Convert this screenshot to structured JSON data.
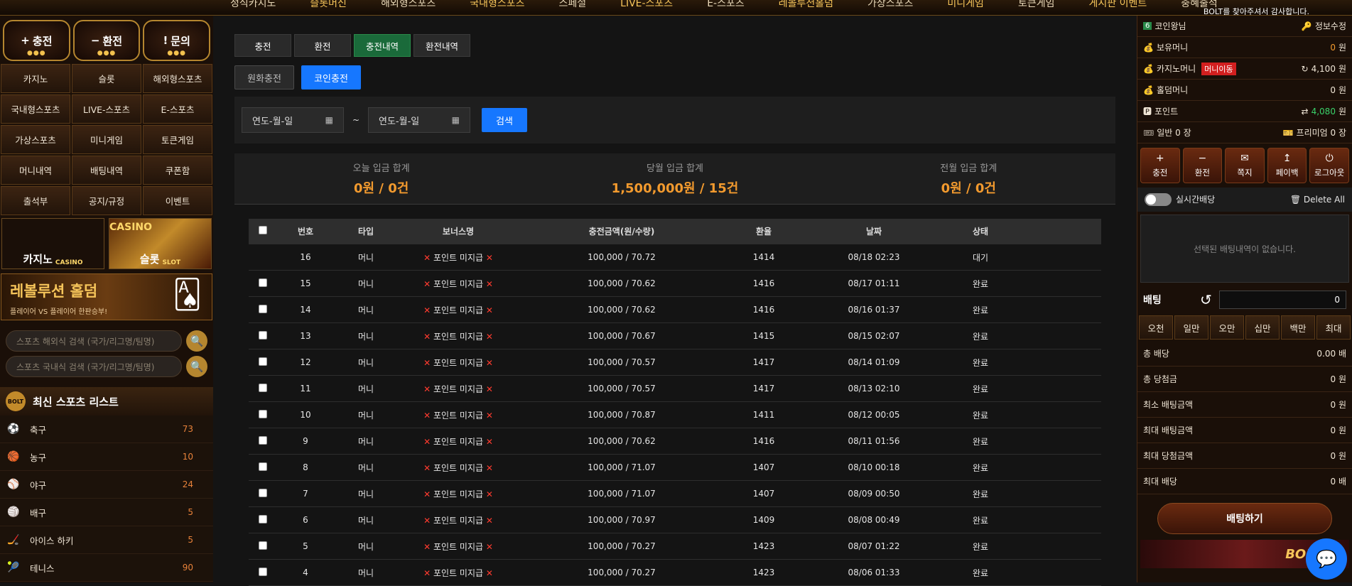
{
  "topnav": {
    "items": [
      "정식카지노",
      "슬롯머신",
      "해외형스포츠",
      "국내형스포츠",
      "스페셜",
      "LIVE-스포츠",
      "E-스포츠",
      "레볼루션홀덤",
      "가상스포츠",
      "미니게임",
      "토큰게임",
      "게시판 이벤트",
      "충혜출석"
    ],
    "notice": "BOLT를 찾아주셔서 감사합니다."
  },
  "left": {
    "header_buttons": [
      {
        "icon": "+",
        "label": "충전"
      },
      {
        "icon": "−",
        "label": "환전"
      },
      {
        "icon": "!",
        "label": "문의"
      }
    ],
    "grid": [
      "카지노",
      "슬롯",
      "해외형스포츠",
      "국내형스포츠",
      "LIVE-스포츠",
      "E-스포츠",
      "가상스포츠",
      "미니게임",
      "토큰게임",
      "머니내역",
      "배팅내역",
      "쿠폰함",
      "출석부",
      "공지/규정",
      "이벤트"
    ],
    "banner_casino": {
      "title": "카지노",
      "sub": "CASINO"
    },
    "banner_slot": {
      "top": "CASINO",
      "title": "슬롯",
      "sub": "SLOT"
    },
    "holdem": {
      "title": "레볼루션 홀덤",
      "sub": "플레이어 VS 플레이어 한판승부!"
    },
    "search_overseas_placeholder": "스포츠 해외식 검색 (국가/리그명/팀명)",
    "search_domestic_placeholder": "스포츠 국내식 검색 (국가/리그명/팀명)",
    "sport_list_title": "최신 스포츠 리스트",
    "sport_list_logo": "BOLT",
    "sports": [
      {
        "name": "축구",
        "count": "73",
        "icon": "⚽"
      },
      {
        "name": "농구",
        "count": "10",
        "icon": "🏀"
      },
      {
        "name": "야구",
        "count": "24",
        "icon": "⚾"
      },
      {
        "name": "배구",
        "count": "5",
        "icon": "🏐"
      },
      {
        "name": "아이스 하키",
        "count": "5",
        "icon": "🏒"
      },
      {
        "name": "테니스",
        "count": "90",
        "icon": "🎾"
      }
    ]
  },
  "main": {
    "tabs": [
      "충전",
      "환전",
      "충전내역",
      "환전내역"
    ],
    "subtabs": [
      "원화충전",
      "코인충전"
    ],
    "date_placeholder": "연도-월-일",
    "tilde": "~",
    "search_label": "검색",
    "summary": [
      {
        "label": "오늘 입금 합계",
        "value": "0원 / 0건"
      },
      {
        "label": "당월 입금 합계",
        "value": "1,500,000원 / 15건"
      },
      {
        "label": "전월 입금 합계",
        "value": "0원 / 0건"
      }
    ],
    "columns": [
      "번호",
      "타입",
      "보너스명",
      "충전금액(원/수량)",
      "환율",
      "날짜",
      "상태"
    ],
    "rows": [
      {
        "no": "16",
        "type": "머니",
        "bonus": "포인트 미지급",
        "amount": "100,000 / 70.72",
        "rate": "1414",
        "date": "08/18 02:23",
        "status": "대기"
      },
      {
        "no": "15",
        "type": "머니",
        "bonus": "포인트 미지급",
        "amount": "100,000 / 70.62",
        "rate": "1416",
        "date": "08/17 01:11",
        "status": "완료"
      },
      {
        "no": "14",
        "type": "머니",
        "bonus": "포인트 미지급",
        "amount": "100,000 / 70.62",
        "rate": "1416",
        "date": "08/16 01:37",
        "status": "완료"
      },
      {
        "no": "13",
        "type": "머니",
        "bonus": "포인트 미지급",
        "amount": "100,000 / 70.67",
        "rate": "1415",
        "date": "08/15 02:07",
        "status": "완료"
      },
      {
        "no": "12",
        "type": "머니",
        "bonus": "포인트 미지급",
        "amount": "100,000 / 70.57",
        "rate": "1417",
        "date": "08/14 01:09",
        "status": "완료"
      },
      {
        "no": "11",
        "type": "머니",
        "bonus": "포인트 미지급",
        "amount": "100,000 / 70.57",
        "rate": "1417",
        "date": "08/13 02:10",
        "status": "완료"
      },
      {
        "no": "10",
        "type": "머니",
        "bonus": "포인트 미지급",
        "amount": "100,000 / 70.87",
        "rate": "1411",
        "date": "08/12 00:05",
        "status": "완료"
      },
      {
        "no": "9",
        "type": "머니",
        "bonus": "포인트 미지급",
        "amount": "100,000 / 70.62",
        "rate": "1416",
        "date": "08/11 01:56",
        "status": "완료"
      },
      {
        "no": "8",
        "type": "머니",
        "bonus": "포인트 미지급",
        "amount": "100,000 / 71.07",
        "rate": "1407",
        "date": "08/10 00:18",
        "status": "완료"
      },
      {
        "no": "7",
        "type": "머니",
        "bonus": "포인트 미지급",
        "amount": "100,000 / 71.07",
        "rate": "1407",
        "date": "08/09 00:50",
        "status": "완료"
      },
      {
        "no": "6",
        "type": "머니",
        "bonus": "포인트 미지급",
        "amount": "100,000 / 70.97",
        "rate": "1409",
        "date": "08/08 00:49",
        "status": "완료"
      },
      {
        "no": "5",
        "type": "머니",
        "bonus": "포인트 미지급",
        "amount": "100,000 / 70.27",
        "rate": "1423",
        "date": "08/07 01:22",
        "status": "완료"
      },
      {
        "no": "4",
        "type": "머니",
        "bonus": "포인트 미지급",
        "amount": "100,000 / 70.27",
        "rate": "1423",
        "date": "08/06 01:33",
        "status": "완료"
      }
    ]
  },
  "right": {
    "level": "6",
    "username": "코인왕님",
    "edit_info": "정보수정",
    "money_label": "보유머니",
    "money_value": "0",
    "won": "원",
    "casino_label": "카지노머니",
    "casino_badge": "머니이동",
    "casino_value": "4,100",
    "holdem_label": "홀덤머니",
    "holdem_value": "0",
    "point_label": "포인트",
    "point_value": "4,080",
    "normal_coupon": "일반 0 장",
    "premium_coupon": "프리미엄 0 장",
    "actions": [
      {
        "icon": "+",
        "label": "충전"
      },
      {
        "icon": "−",
        "label": "환전"
      },
      {
        "icon": "✉",
        "label": "쪽지"
      },
      {
        "icon": "↥",
        "label": "페이백"
      },
      {
        "icon": "⏻",
        "label": "로그아웃"
      }
    ],
    "realtime_label": "실시간배당",
    "delete_all": "Delete All",
    "empty_bets": "선택된 배팅내역이 없습니다.",
    "bet_label": "배팅",
    "bet_input": "0",
    "amounts": [
      "오천",
      "일만",
      "오만",
      "십만",
      "백만",
      "최대"
    ],
    "info": [
      {
        "label": "총 배당",
        "value": "0.00 배"
      },
      {
        "label": "총 당첨금",
        "value": "0 원"
      },
      {
        "label": "최소 배팅금액",
        "value": "0 원"
      },
      {
        "label": "최대 배팅금액",
        "value": "0 원"
      },
      {
        "label": "최대 당첨금액",
        "value": "0 원"
      },
      {
        "label": "최대 배당",
        "value": "0 배"
      }
    ],
    "bet_button": "배팅하기",
    "banner_text": "BOLT"
  },
  "chat_icon": "chat-icon"
}
